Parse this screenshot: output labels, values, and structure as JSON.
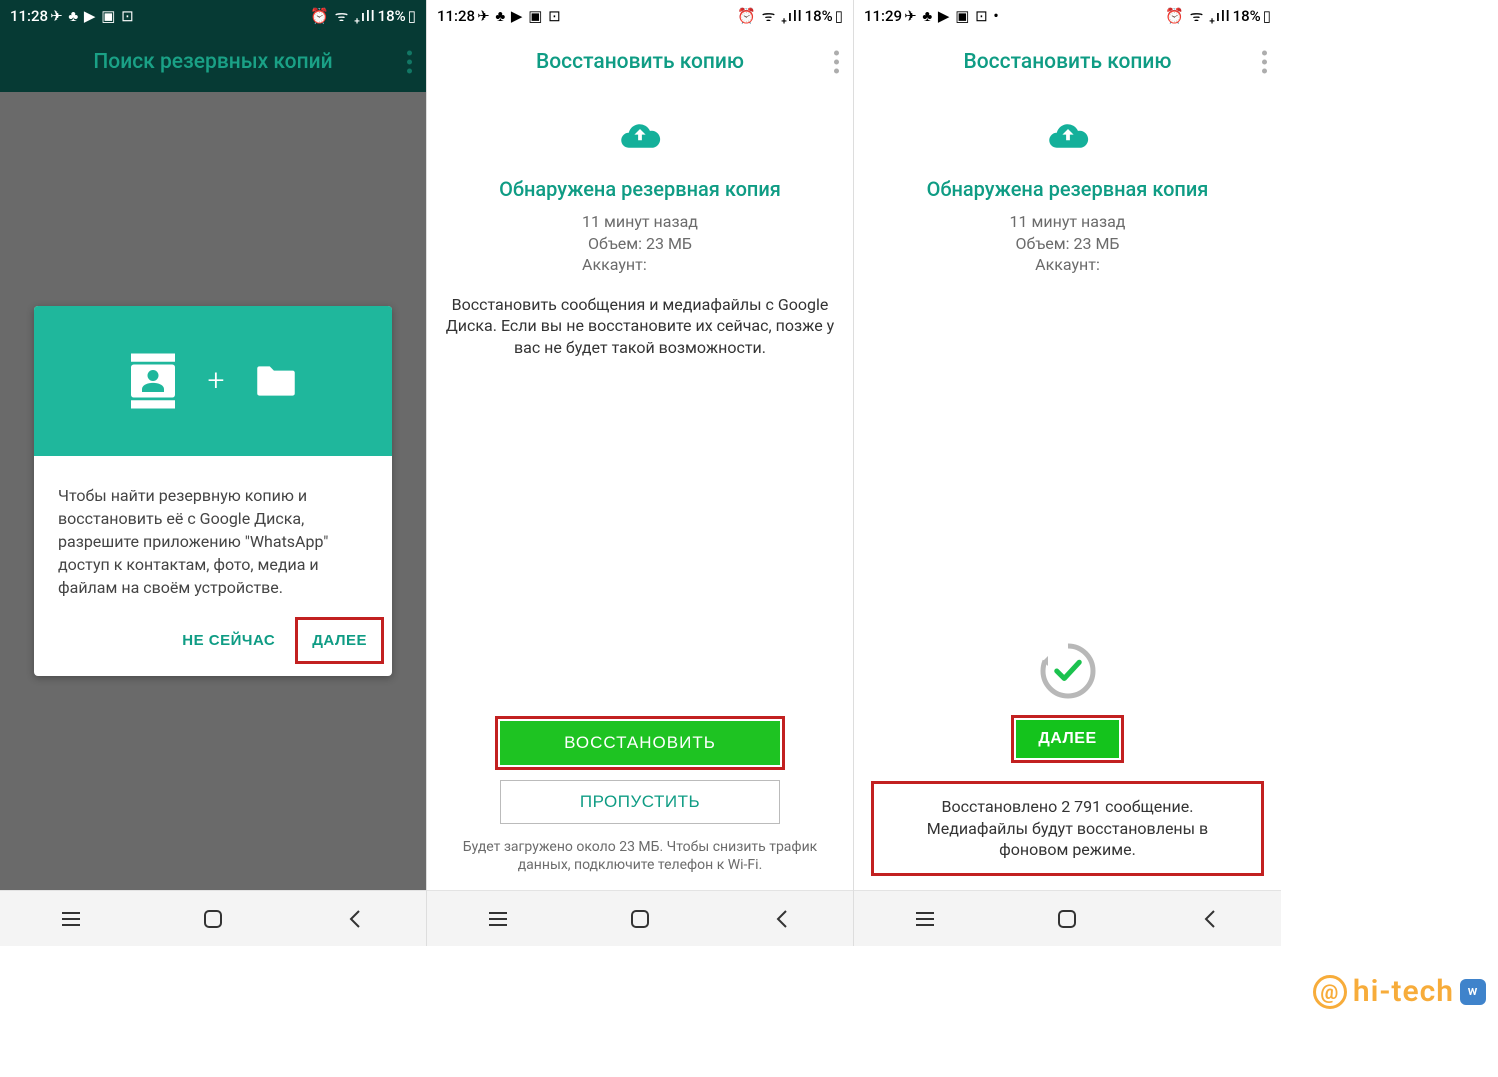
{
  "screen1": {
    "status": {
      "time": "11:28",
      "battery": "18%"
    },
    "title": "Поиск резервных копий",
    "card_text": "Чтобы найти резервную копию и восстановить её с Google Диска, разрешите приложению \"WhatsApp\" доступ к контактам, фото, медиа и файлам на своём устройстве.",
    "btn_not_now": "НЕ СЕЙЧАС",
    "btn_next": "ДАЛЕЕ"
  },
  "screen2": {
    "status": {
      "time": "11:28",
      "battery": "18%"
    },
    "title": "Восстановить копию",
    "headline": "Обнаружена резервная копия",
    "meta_time": "11 минут назад",
    "meta_size": "Объем: 23 МБ",
    "meta_account": "Аккаунт:",
    "desc": "Восстановить сообщения и медиафайлы с Google Диска. Если вы не восстановите их сейчас, позже у вас не будет такой возможности.",
    "btn_restore": "ВОССТАНОВИТЬ",
    "btn_skip": "ПРОПУСТИТЬ",
    "footer": "Будет загружено около 23 МБ. Чтобы снизить трафик данных, подключите телефон к Wi-Fi."
  },
  "screen3": {
    "status": {
      "time": "11:29",
      "battery": "18%"
    },
    "title": "Восстановить копию",
    "headline": "Обнаружена резервная копия",
    "meta_time": "11 минут назад",
    "meta_size": "Объем: 23 МБ",
    "meta_account": "Аккаунт:",
    "btn_next": "ДАЛЕЕ",
    "result": "Восстановлено 2 791 сообщение. Медиафайлы будут восстановлены в фоновом режиме."
  },
  "watermark": "hi-tech"
}
